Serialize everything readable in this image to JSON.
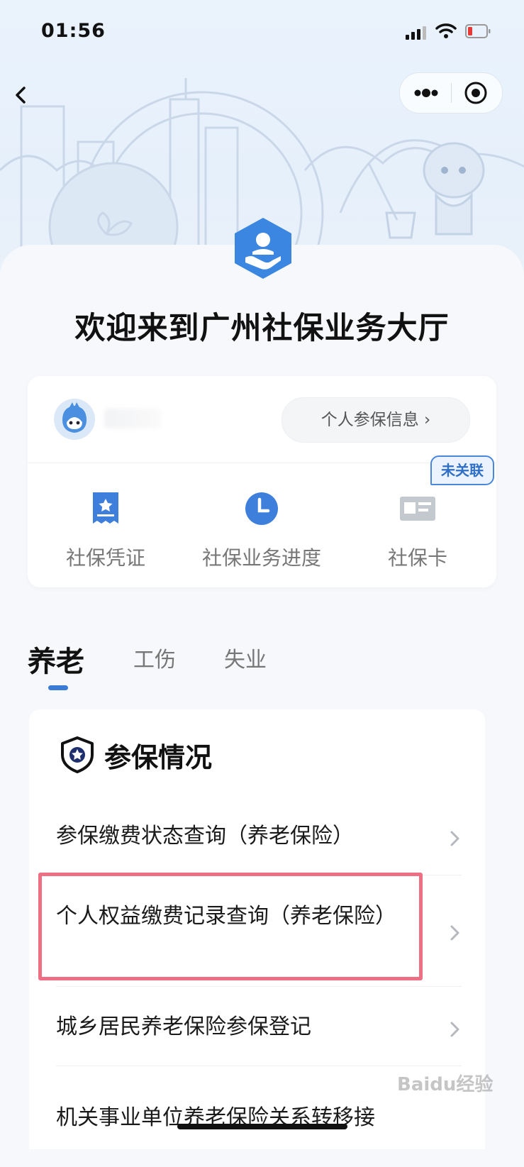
{
  "status_bar": {
    "time": "01:56"
  },
  "header": {
    "welcome": "欢迎来到广州社保业务大厅"
  },
  "profile": {
    "personal_info_button": "个人参保信息 ›"
  },
  "quick_actions": [
    {
      "label": "社保凭证"
    },
    {
      "label": "社保业务进度"
    },
    {
      "label": "社保卡",
      "badge": "未关联"
    }
  ],
  "tabs": [
    {
      "label": "养老"
    },
    {
      "label": "工伤"
    },
    {
      "label": "失业"
    }
  ],
  "section": {
    "title": "参保情况",
    "items": [
      {
        "label": "参保缴费状态查询（养老保险）"
      },
      {
        "label": "个人权益缴费记录查询（养老保险）"
      },
      {
        "label": "城乡居民养老保险参保登记"
      },
      {
        "label": "机关事业单位养老保险关系转移接"
      }
    ]
  },
  "watermark": "Baidu经验",
  "colors": {
    "accent": "#3a7bd5",
    "highlight": "#ee6f83",
    "badge": "#4a87d8"
  }
}
